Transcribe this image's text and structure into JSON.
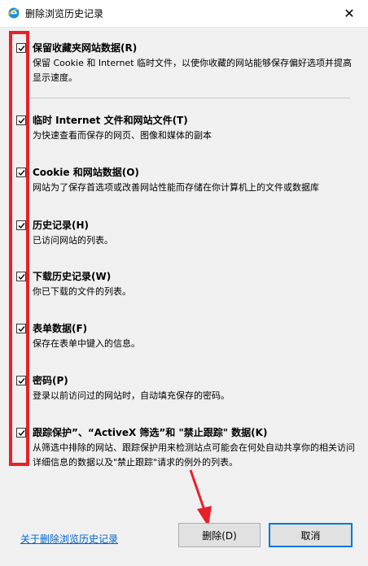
{
  "window": {
    "title": "删除浏览历史记录",
    "close_label": "✕"
  },
  "items": [
    {
      "title": "保留收藏夹网站数据(R)",
      "desc": "保留 Cookie 和 Internet 临时文件，以使你收藏的网站能够保存偏好选项并提高显示速度。",
      "checked": true
    },
    {
      "title": "临时 Internet 文件和网站文件(T)",
      "desc": "为快速查看而保存的网页、图像和媒体的副本",
      "checked": true
    },
    {
      "title": "Cookie 和网站数据(O)",
      "desc": "网站为了保存首选项或改善网站性能而存储在你计算机上的文件或数据库",
      "checked": true
    },
    {
      "title": "历史记录(H)",
      "desc": "已访问网站的列表。",
      "checked": true
    },
    {
      "title": "下载历史记录(W)",
      "desc": "你已下载的文件的列表。",
      "checked": true
    },
    {
      "title": "表单数据(F)",
      "desc": "保存在表单中键入的信息。",
      "checked": true
    },
    {
      "title": "密码(P)",
      "desc": "登录以前访问过的网站时，自动填充保存的密码。",
      "checked": true
    },
    {
      "title": "跟踪保护”、“ActiveX 筛选”和 \"禁止跟踪\" 数据(K)",
      "desc": "从筛选中排除的网站、跟踪保护用来检测站点可能会在何处自动共享你的相关访问详细信息的数据以及\"禁止跟踪\"请求的例外的列表。",
      "checked": true
    }
  ],
  "footer": {
    "link_label": "关于删除浏览历史记录",
    "delete_label": "删除(D)",
    "cancel_label": "取消"
  },
  "colors": {
    "highlight": "#e8202a",
    "link": "#0066cc",
    "focus_border": "#0078d7"
  }
}
